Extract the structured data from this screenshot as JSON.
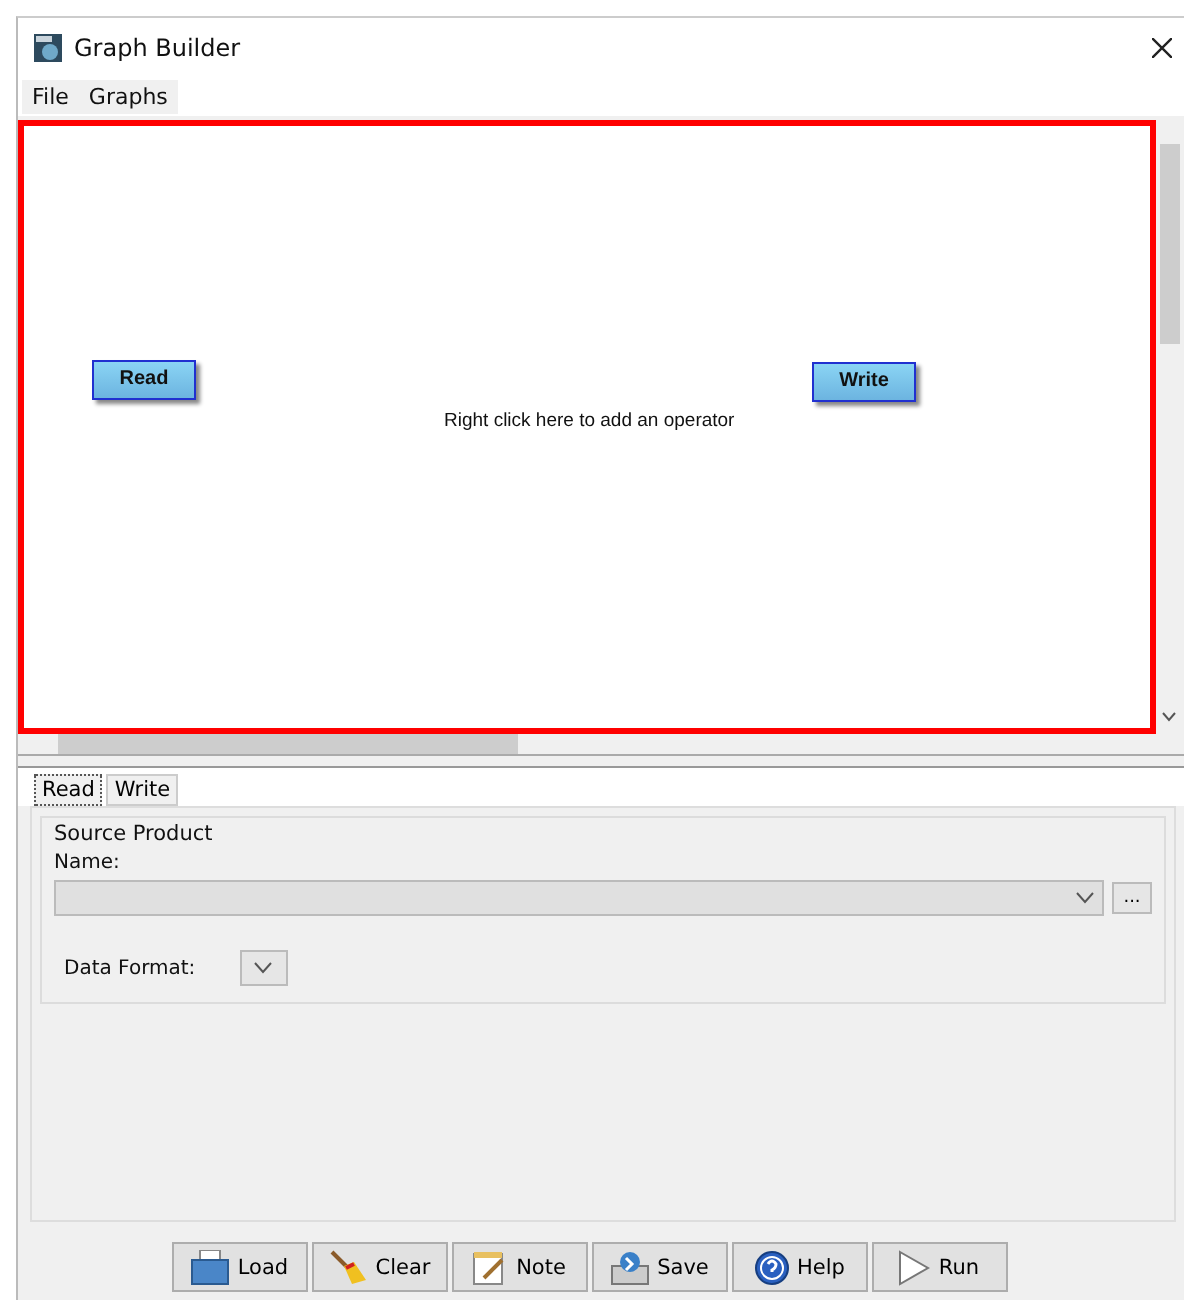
{
  "window": {
    "title": "Graph Builder"
  },
  "menu": [
    "File",
    "Graphs"
  ],
  "canvas": {
    "hint": "Right click here to add an operator",
    "nodes": [
      {
        "label": "Read"
      },
      {
        "label": "Write"
      }
    ]
  },
  "tabs": [
    {
      "label": "Read",
      "selected": true
    },
    {
      "label": "Write",
      "selected": false
    }
  ],
  "source_product": {
    "title": "Source Product",
    "name_label": "Name:",
    "browse": "...",
    "format_label": "Data Format:"
  },
  "buttons": [
    {
      "label": "Load",
      "kind": "folder"
    },
    {
      "label": "Clear",
      "kind": "broom"
    },
    {
      "label": "Note",
      "kind": "note"
    },
    {
      "label": "Save",
      "kind": "save"
    },
    {
      "label": "Help",
      "kind": "help"
    },
    {
      "label": "Run",
      "kind": "run"
    }
  ]
}
